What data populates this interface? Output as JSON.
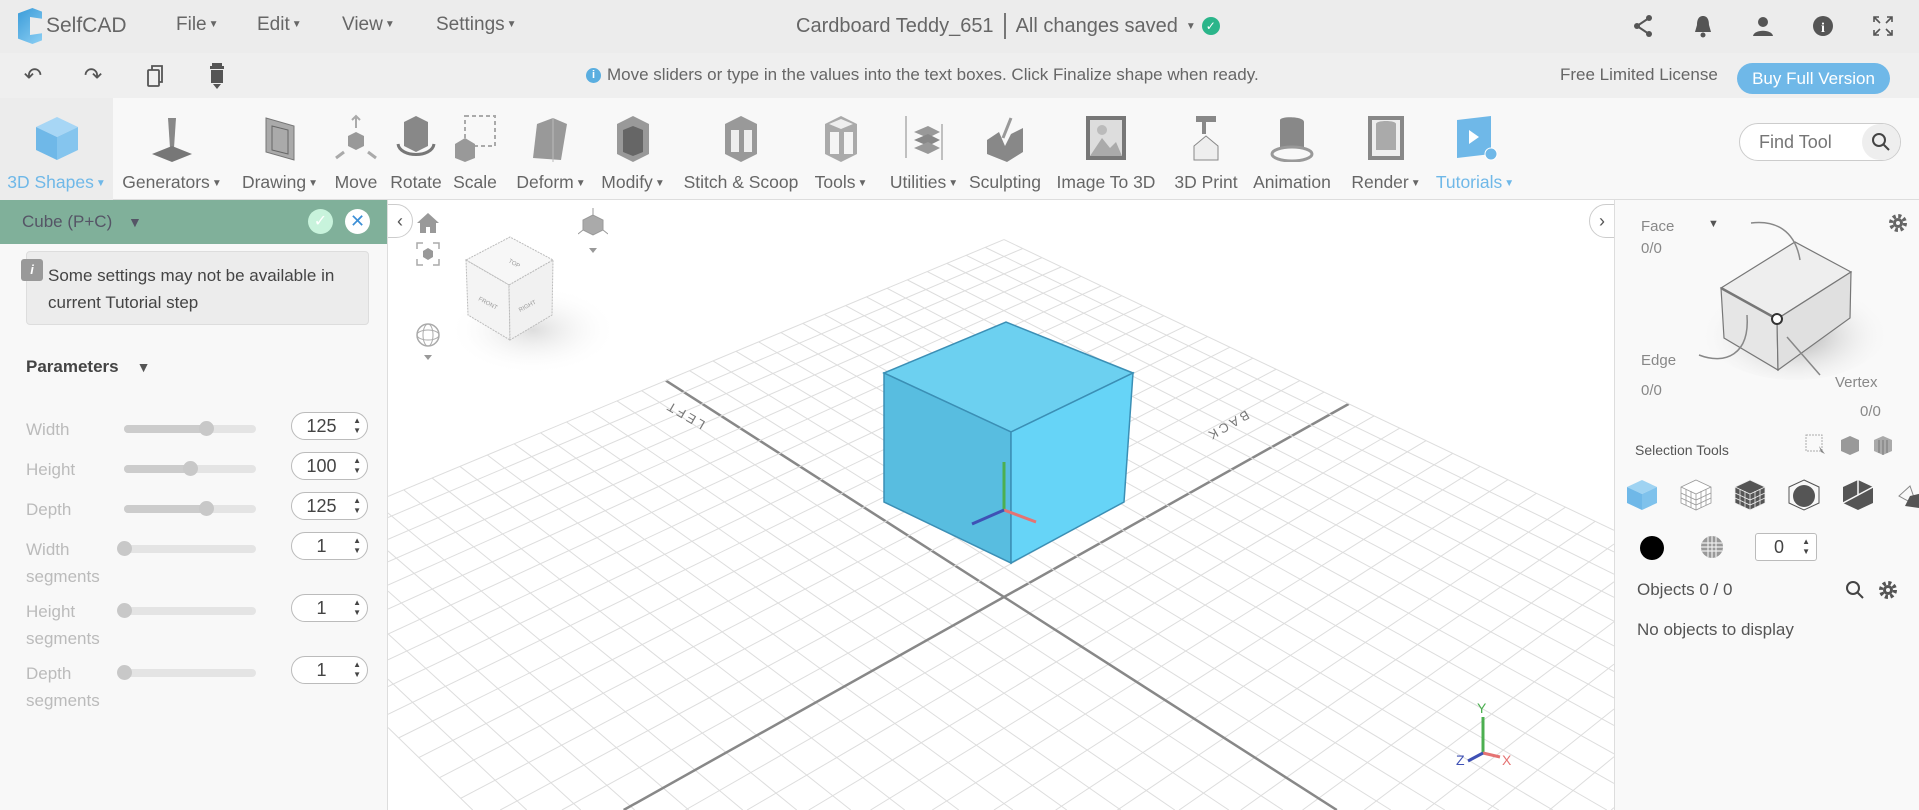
{
  "app": {
    "name": "SelfCAD"
  },
  "menu": [
    "File",
    "Edit",
    "View",
    "Settings"
  ],
  "document": {
    "title": "Cardboard Teddy_651",
    "status": "All changes saved"
  },
  "top_icons": [
    "share-icon",
    "bell-icon",
    "user-icon",
    "info-icon",
    "fullscreen-icon"
  ],
  "hint": "Move sliders or type in the values into the text boxes. Click Finalize shape when ready.",
  "license": {
    "label": "Free Limited License",
    "buy": "Buy Full Version"
  },
  "tools": [
    {
      "label": "3D Shapes",
      "dropdown": true,
      "active": true
    },
    {
      "label": "Generators",
      "dropdown": true
    },
    {
      "label": "Drawing",
      "dropdown": true
    },
    {
      "label": "Move"
    },
    {
      "label": "Rotate"
    },
    {
      "label": "Scale"
    },
    {
      "label": "Deform",
      "dropdown": true
    },
    {
      "label": "Modify",
      "dropdown": true
    },
    {
      "label": "Stitch & Scoop"
    },
    {
      "label": "Tools",
      "dropdown": true
    },
    {
      "label": "Utilities",
      "dropdown": true
    },
    {
      "label": "Sculpting"
    },
    {
      "label": "Image To 3D"
    },
    {
      "label": "3D Print"
    },
    {
      "label": "Animation"
    },
    {
      "label": "Render",
      "dropdown": true
    },
    {
      "label": "Tutorials",
      "dropdown": true
    }
  ],
  "find_tool": {
    "placeholder": "Find Tool"
  },
  "panel": {
    "title": "Cube (P+C)",
    "notice": "Some settings may not be available in current Tutorial step",
    "section": "Parameters",
    "params": [
      {
        "label": "Width",
        "value": "125",
        "slider": 0.62
      },
      {
        "label": "Height",
        "value": "100",
        "slider": 0.5
      },
      {
        "label": "Depth",
        "value": "125",
        "slider": 0.62
      },
      {
        "label": "Width segments",
        "value": "1",
        "slider": 0
      },
      {
        "label": "Height segments",
        "value": "1",
        "slider": 0
      },
      {
        "label": "Depth segments",
        "value": "1",
        "slider": 0
      }
    ]
  },
  "viewport": {
    "labels": {
      "left": "LEFT",
      "back": "BACK"
    },
    "cube_faces": {
      "top": "TOP",
      "front": "FRONT",
      "right": "RIGHT"
    },
    "axes": {
      "x": "X",
      "y": "Y",
      "z": "Z"
    },
    "cube_color": "#6cd0f0"
  },
  "right_panel": {
    "face": {
      "label": "Face",
      "count": "0/0"
    },
    "edge": {
      "label": "Edge",
      "count": "0/0"
    },
    "vertex": {
      "label": "Vertex",
      "count": "0/0"
    },
    "selection_tools": "Selection Tools",
    "value": "0",
    "objects": "Objects 0 / 0",
    "empty": "No objects to display"
  }
}
